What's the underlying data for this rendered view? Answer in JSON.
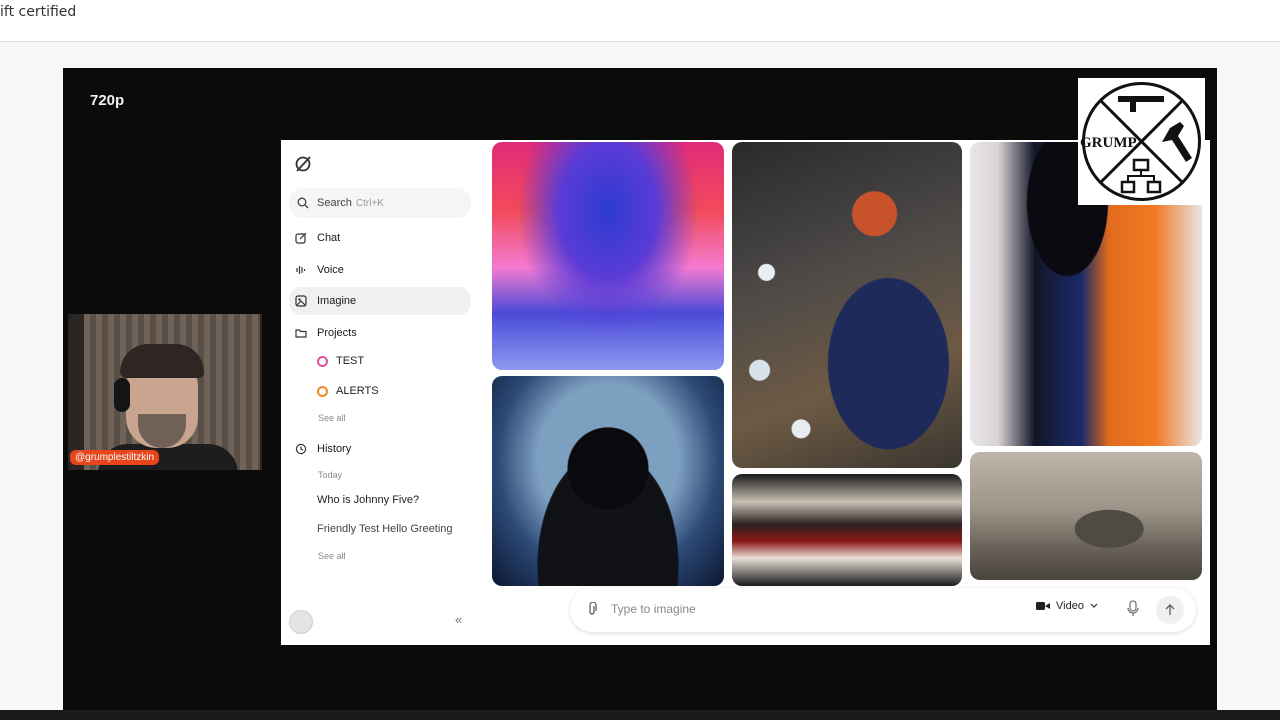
{
  "page_header": {
    "text": "ift certified"
  },
  "player": {
    "quality_label": "720p"
  },
  "webcam": {
    "handle": "@grumplestiltzkin"
  },
  "badge": {
    "text": "GRUMP"
  },
  "app": {
    "search": {
      "label": "Search",
      "shortcut": "Ctrl+K"
    },
    "nav": [
      {
        "label": "Chat",
        "icon": "edit-icon"
      },
      {
        "label": "Voice",
        "icon": "voice-wave-icon"
      },
      {
        "label": "Imagine",
        "icon": "image-grid-icon"
      },
      {
        "label": "Projects",
        "icon": "folder-icon"
      }
    ],
    "projects": [
      {
        "label": "TEST",
        "color": "#e0529a"
      },
      {
        "label": "ALERTS",
        "color": "#f08a24"
      }
    ],
    "projects_see_all": "See all",
    "history": {
      "label": "History",
      "group": "Today",
      "items": [
        "Who is Johnny Five?",
        "Friendly Test Hello Greeting"
      ],
      "see_all": "See all"
    },
    "prompt": {
      "placeholder": "Type to imagine",
      "mode": "Video"
    }
  }
}
